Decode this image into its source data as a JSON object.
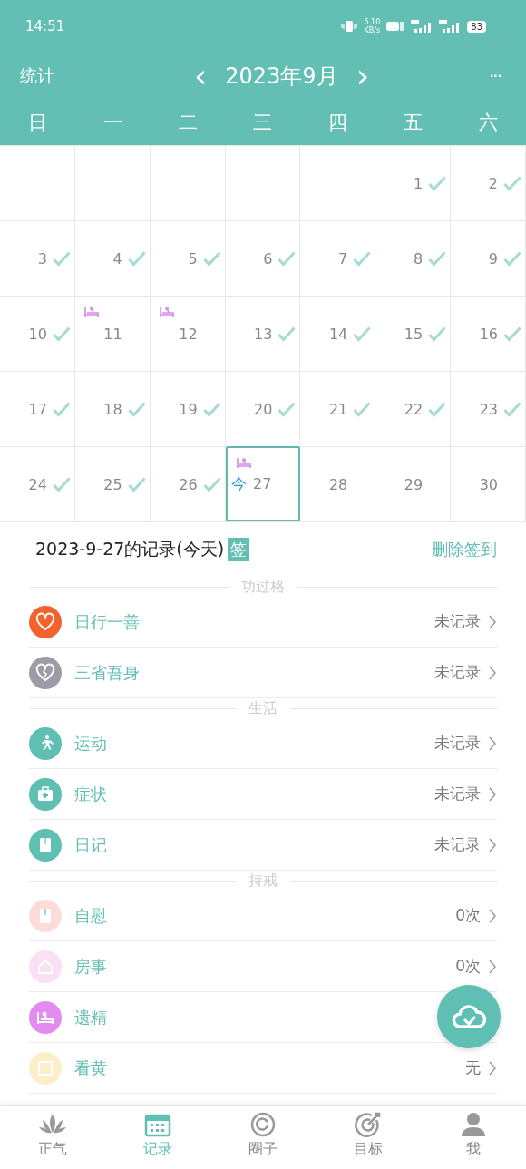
{
  "status_bar": {
    "time": "14:51",
    "speed": "6.10",
    "speed_unit": "KB/s",
    "battery": "83"
  },
  "header": {
    "left": "统计",
    "title": "2023年9月",
    "prev": "‹",
    "next": "›",
    "more": "···"
  },
  "weekdays": [
    "日",
    "一",
    "二",
    "三",
    "四",
    "五",
    "六"
  ],
  "days": [
    {
      "kind": "blank"
    },
    {
      "kind": "blank"
    },
    {
      "kind": "blank"
    },
    {
      "kind": "blank"
    },
    {
      "kind": "blank"
    },
    {
      "kind": "day",
      "day": "1",
      "checked": true,
      "dream": false,
      "selected": false
    },
    {
      "day": "2",
      "checked": true,
      "dream": false,
      "selected": false
    },
    {
      "day": "3",
      "checked": true,
      "dream": false,
      "selected": false
    },
    {
      "day": "4",
      "checked": true,
      "dream": false,
      "selected": false
    },
    {
      "day": "5",
      "checked": true,
      "dream": false,
      "selected": false
    },
    {
      "day": "6",
      "checked": true,
      "dream": false,
      "selected": false
    },
    {
      "day": "7",
      "checked": true,
      "dream": false,
      "selected": false
    },
    {
      "day": "8",
      "checked": true,
      "dream": false,
      "selected": false
    },
    {
      "day": "9",
      "checked": true,
      "dream": false,
      "selected": false
    },
    {
      "day": "10",
      "checked": true,
      "dream": false,
      "selected": false
    },
    {
      "day": "11",
      "checked": false,
      "dream": true,
      "selected": false
    },
    {
      "day": "12",
      "checked": false,
      "dream": true,
      "selected": false
    },
    {
      "day": "13",
      "checked": true,
      "dream": false,
      "selected": false
    },
    {
      "day": "14",
      "checked": true,
      "dream": false,
      "selected": false
    },
    {
      "day": "15",
      "checked": true,
      "dream": false,
      "selected": false
    },
    {
      "day": "16",
      "checked": true,
      "dream": false,
      "selected": false
    },
    {
      "day": "17",
      "checked": true,
      "dream": false,
      "selected": false
    },
    {
      "day": "18",
      "checked": true,
      "dream": false,
      "selected": false
    },
    {
      "day": "19",
      "checked": true,
      "dream": false,
      "selected": false
    },
    {
      "day": "20",
      "checked": true,
      "dream": false,
      "selected": false
    },
    {
      "day": "21",
      "checked": true,
      "dream": false,
      "selected": false
    },
    {
      "day": "22",
      "checked": true,
      "dream": false,
      "selected": false
    },
    {
      "day": "23",
      "checked": true,
      "dream": false,
      "selected": false
    },
    {
      "day": "24",
      "checked": true,
      "dream": false,
      "selected": false
    },
    {
      "day": "25",
      "checked": true,
      "dream": false,
      "selected": false
    },
    {
      "day": "26",
      "checked": true,
      "dream": false,
      "selected": false
    },
    {
      "day": "27",
      "checked": false,
      "dream": true,
      "selected": true,
      "today_label": "今"
    },
    {
      "day": "28",
      "checked": false,
      "dream": false,
      "selected": false
    },
    {
      "day": "29",
      "checked": false,
      "dream": false,
      "selected": false
    },
    {
      "day": "30",
      "checked": false,
      "dream": false,
      "selected": false
    }
  ],
  "record": {
    "title": "2023-9-27的记录(今天)",
    "badge": "签",
    "action": "删除签到"
  },
  "sections": [
    {
      "title": "功过格",
      "items": [
        {
          "label": "日行一善",
          "value": "未记录",
          "kind": "heart",
          "color": "#f4622e"
        },
        {
          "label": "三省吾身",
          "value": "未记录",
          "kind": "broken-heart",
          "color": "#9d9ca6"
        }
      ]
    },
    {
      "title": "生活",
      "items": [
        {
          "label": "运动",
          "value": "未记录",
          "kind": "runner",
          "color": "#5fbfb3"
        },
        {
          "label": "症状",
          "value": "未记录",
          "kind": "medkit",
          "color": "#5fbfb3"
        },
        {
          "label": "日记",
          "value": "未记录",
          "kind": "diary",
          "color": "#5fbfb3"
        }
      ]
    },
    {
      "title": "持戒",
      "items": [
        {
          "label": "自慰",
          "value": "0次",
          "kind": "diary",
          "color": "#fbdcd8"
        },
        {
          "label": "房事",
          "value": "0次",
          "kind": "house",
          "color": "#f9e0f4"
        },
        {
          "label": "遗精",
          "kind": "bed",
          "color": "#e28cf0"
        },
        {
          "label": "看黄",
          "value": "无",
          "kind": "frame",
          "color": "#fcefc8"
        }
      ]
    }
  ],
  "nav": [
    {
      "label": "正气",
      "kind": "lotus",
      "selected": false
    },
    {
      "label": "记录",
      "kind": "calendar",
      "selected": true
    },
    {
      "label": "圈子",
      "kind": "circle",
      "selected": false
    },
    {
      "label": "目标",
      "kind": "target",
      "selected": false
    },
    {
      "label": "我",
      "kind": "person",
      "selected": false
    }
  ]
}
